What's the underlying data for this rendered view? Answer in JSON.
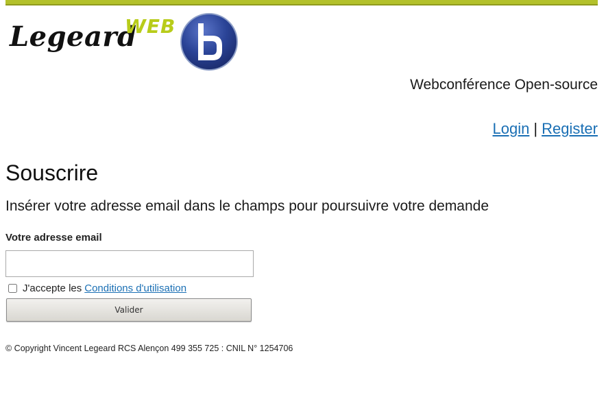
{
  "header": {
    "logo_text": "Legeard",
    "logo_web": "WEB",
    "tagline": "Webconférence Open-source",
    "login_label": "Login",
    "separator": "|",
    "register_label": "Register"
  },
  "main": {
    "title": "Souscrire",
    "intro": "Insérer votre adresse email dans le champs pour poursuivre votre demande",
    "email_label": "Votre adresse email",
    "email_value": "",
    "terms_prefix": "J'accepte les",
    "terms_link": "Conditions d'utilisation",
    "terms_checked": false,
    "submit_label": "Valider"
  },
  "footer": {
    "copyright": "© Copyright Vincent Legeard RCS Alençon 499 355 725 : CNIL N° 1254706"
  },
  "colors": {
    "accent_bar": "#b3c12b",
    "web_green": "#b8cc1a",
    "badge_blue": "#233a8c",
    "link_blue": "#1a6fb4"
  },
  "icons": {
    "badge": "bigbluebutton-logo-icon"
  }
}
